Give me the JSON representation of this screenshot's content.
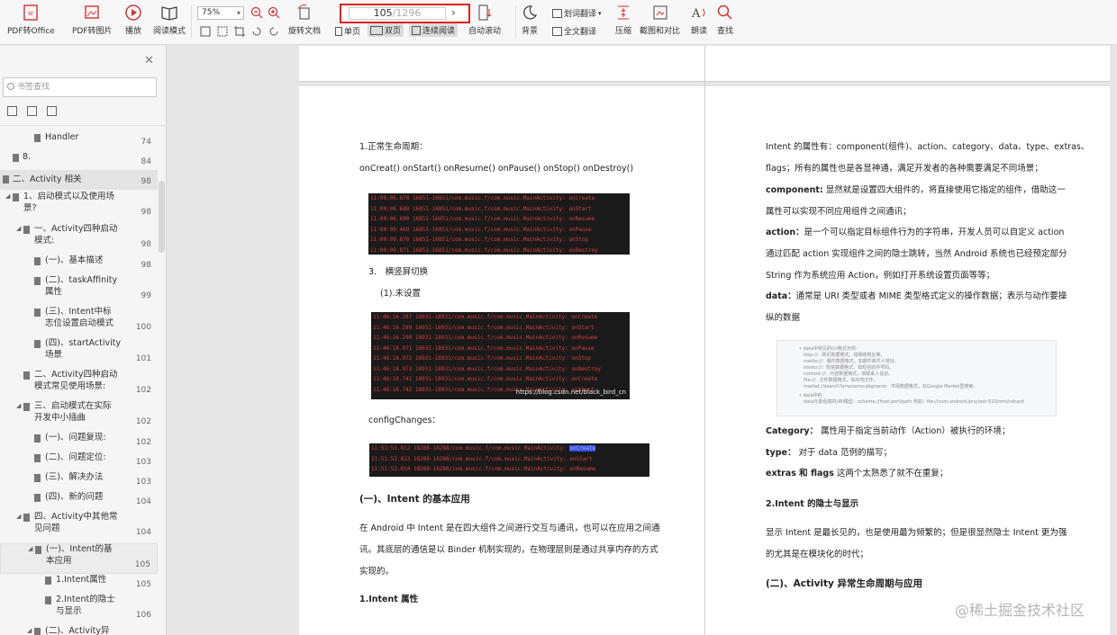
{
  "toolbar": {
    "pdf_to_office": "PDF转Office",
    "pdf_to_image": "PDF转图片",
    "play": "播放",
    "read_mode": "阅读模式",
    "zoom": "75%",
    "rotate": "旋转文档",
    "single_page": "单页",
    "double_page": "双页",
    "continuous": "连续阅读",
    "auto_scroll": "自动滚动",
    "background": "背景",
    "word_translate": "划词翻译",
    "full_translate": "全文翻译",
    "compress": "压缩",
    "screenshot_compare": "截图和对比",
    "read_aloud": "朗读",
    "find": "查找",
    "page_current": "105",
    "page_total": "/1296"
  },
  "sidebar": {
    "search_placeholder": "书签查找",
    "items": [
      {
        "label": "Handler",
        "page": "74"
      },
      {
        "label": "8.",
        "page": "84"
      },
      {
        "label": "二、Activity 相关",
        "page": "98"
      },
      {
        "label": "1、启动模式以及使用场",
        "label2": "景?",
        "page": "98"
      },
      {
        "label": "一、Activity四种启动",
        "label2": "模式:",
        "page": "98"
      },
      {
        "label": "(一)、基本描述",
        "page": "98"
      },
      {
        "label": "(二)、taskAffinity",
        "label2": "属性",
        "page": "99"
      },
      {
        "label": "(三)、Intent中标",
        "label2": "志位设置启动模式",
        "page": "100"
      },
      {
        "label": "(四)、startActivity",
        "label2": "场景",
        "page": "101"
      },
      {
        "label": "二、Activity四种启动",
        "label2": "模式常见使用场景:",
        "page": "102"
      },
      {
        "label": "三、启动模式在实际",
        "label2": "开发中小插曲",
        "page": "102"
      },
      {
        "label": "(一)、问题复现:",
        "page": "102"
      },
      {
        "label": "(二)、问题定位:",
        "page": "103"
      },
      {
        "label": "(三)、解决办法",
        "page": "103"
      },
      {
        "label": "(四)、新的问题",
        "page": "104"
      },
      {
        "label": "四、Activity中其他常",
        "label2": "见问题",
        "page": "104"
      },
      {
        "label": "(一)、Intent的基",
        "label2": "本应用",
        "page": "105"
      },
      {
        "label": "1.Intent属性",
        "page": "105"
      },
      {
        "label": "2.Intent的隐士",
        "label2": "与显示",
        "page": "106"
      },
      {
        "label": "(二)、Activity异",
        "page": ""
      }
    ]
  },
  "left_page": {
    "lifecycle_title": "1.正常生命周期：",
    "lifecycle_methods": "onCreat() onStart() onResume() onPause() onStop() onDestroy()",
    "rotate_title": "3.　横竖屏切换",
    "not_set": "(1).未设置",
    "watermark": "https://blog.csdn.net/black_bird_cn",
    "config_changes": "configChanges：",
    "section_heading": "(一)、Intent 的基本应用",
    "para1": "在 Android 中 Intent 是在四大组件之间进行交互与通讯，也可以在应用之间通",
    "para2": "讯。其底层的通信是以 Binder 机制实现的，在物理层则是通过共享内存的方式",
    "para3": "实现的。",
    "sub_heading": "1.Intent 属性"
  },
  "right_page": {
    "l1": "Intent 的属性有：component(组件)、action、category、data、type、extras、",
    "l2": "flags；所有的属性也是各显神通，满足开发者的各种需要满足不同场景；",
    "component_label": "component:",
    "component_text": " 显然就是设置四大组件的，将直接使用它指定的组件，借助这一",
    "l4": "属性可以实现不同应用组件之间通讯；",
    "action_label": "action：",
    "action_text": "是一个可以指定目标组件行为的字符串，开发人员可以自定义 action",
    "l6": "通过匹配 action 实现组件之间的隐士跳转，当然 Android 系统也已经预定部分",
    "l7": "String 作为系统应用 Action，例如打开系统设置页面等等；",
    "data_label": "data：",
    "data_text": "通常是 URI 类型或者 MIME 类型格式定义的操作数据；表示与动作要操",
    "l9": "纵的数据",
    "category_label": "Category：",
    "category_text": " 属性用于指定当前动作（Action）被执行的环境；",
    "type_label": "type：",
    "type_text": " 对于 data 范例的描写；",
    "extras_label": "extras 和 flags",
    "extras_text": " 这两个太熟悉了就不在重复；",
    "implicit_heading": "2.Intent 的隐士与显示",
    "p1": "显示 Intent 是最长见的，也是使用最为频繁的；但是很显然隐士 Intent 更为强",
    "p2": "的尤其是在模块化的时代；",
    "section2": "(二)、Activity 异常生命周期与应用"
  },
  "screen_watermark": "@稀土掘金技术社区"
}
